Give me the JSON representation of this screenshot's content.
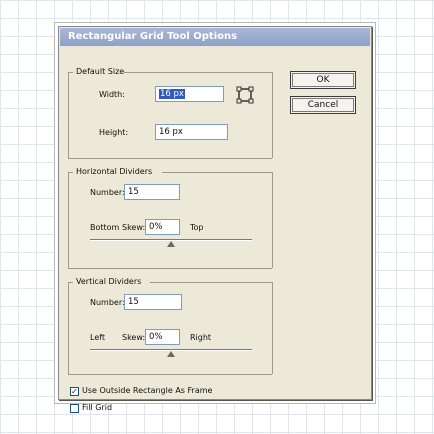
{
  "dialog": {
    "title": "Rectangular Grid Tool Options"
  },
  "default_size": {
    "group_label": "Default Size",
    "width_label": "Width:",
    "width_value": "16 px",
    "height_label": "Height:",
    "height_value": "16 px"
  },
  "horizontal": {
    "group_label": "Horizontal Dividers",
    "number_label": "Number:",
    "number_value": "15",
    "bottom_label": "Bottom",
    "skew_label": "Skew:",
    "skew_value": "0%",
    "top_label": "Top",
    "skew_slider": 0.5
  },
  "vertical": {
    "group_label": "Vertical Dividers",
    "number_label": "Number:",
    "number_value": "15",
    "left_label": "Left",
    "skew_label": "Skew:",
    "skew_value": "0%",
    "right_label": "Right",
    "skew_slider": 0.5
  },
  "options": {
    "use_outside_label": "Use Outside Rectangle As Frame",
    "use_outside_checked": true,
    "fill_grid_label": "Fill Grid",
    "fill_grid_checked": false
  },
  "buttons": {
    "ok_label": "OK",
    "cancel_label": "Cancel"
  },
  "icons": [
    "origin-point-icon"
  ],
  "colors": {
    "title_bar": "#9aabd0",
    "dialog_bg": "#ece9d8",
    "selection": "#2f5ac0"
  }
}
